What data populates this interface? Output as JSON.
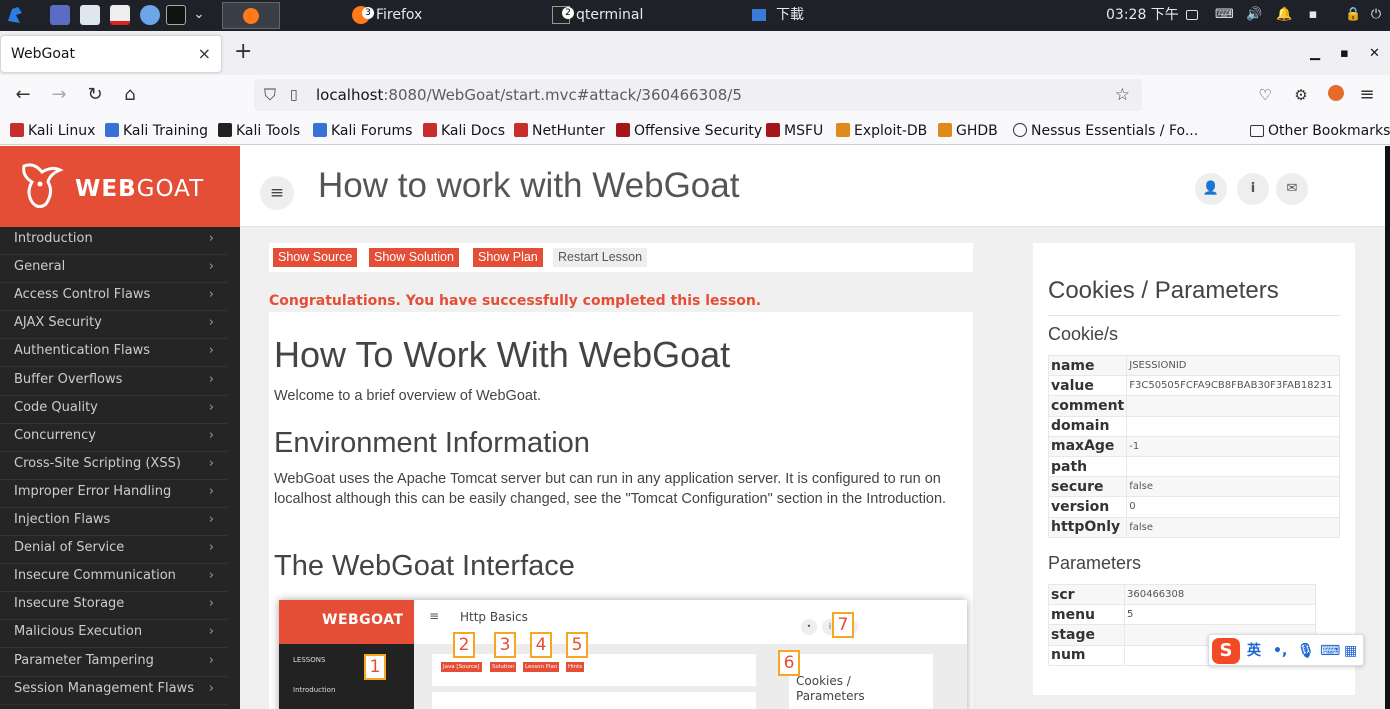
{
  "taskbar": {
    "tasks": [
      {
        "label": "Firefox",
        "badge": "3"
      },
      {
        "label": "qterminal",
        "badge": "2"
      },
      {
        "label": "下載"
      }
    ],
    "clock": "03:28 下午"
  },
  "browser": {
    "tab_title": "WebGoat",
    "tab_close": "×",
    "new_tab": "+",
    "url_host": "localhost",
    "url_path": ":8080/WebGoat/start.mvc#attack/360466308/5",
    "bookmarks": [
      "Kali Linux",
      "Kali Training",
      "Kali Tools",
      "Kali Forums",
      "Kali Docs",
      "NetHunter",
      "Offensive Security",
      "MSFU",
      "Exploit-DB",
      "GHDB",
      "Nessus Essentials / Fo..."
    ],
    "other_bookmarks": "Other Bookmarks"
  },
  "webgoat": {
    "logo_web": "WEB",
    "logo_goat": "GOAT",
    "page_title": "How to work with WebGoat",
    "sidebar": [
      "Introduction",
      "General",
      "Access Control Flaws",
      "AJAX Security",
      "Authentication Flaws",
      "Buffer Overflows",
      "Code Quality",
      "Concurrency",
      "Cross-Site Scripting (XSS)",
      "Improper Error Handling",
      "Injection Flaws",
      "Denial of Service",
      "Insecure Communication",
      "Insecure Storage",
      "Malicious Execution",
      "Parameter Tampering",
      "Session Management Flaws"
    ],
    "buttons": {
      "show_source": "Show Source",
      "show_solution": "Show Solution",
      "show_plan": "Show Plan",
      "restart": "Restart Lesson"
    },
    "congrats": "Congratulations. You have successfully completed this lesson.",
    "lesson": {
      "h1": "How To Work With WebGoat",
      "intro": "Welcome to a brief overview of WebGoat.",
      "h2_env": "Environment Information",
      "env_text": "WebGoat uses the Apache Tomcat server but can run in any application server. It is configured to run on localhost although this can be easily changed, see the \"Tomcat Configuration\" section in the Introduction.",
      "h2_iface": "The WebGoat Interface"
    },
    "screenshot": {
      "logo": "WEBGOAT",
      "title": "Http Basics",
      "side_lessons": "LESSONS",
      "side_intro": "Introduction",
      "buttons": [
        "Java [Source]",
        "Solution",
        "Lesson Plan",
        "Hints"
      ],
      "right_title": "Cookies / Parameters",
      "numbers": [
        "1",
        "2",
        "3",
        "4",
        "5",
        "6",
        "7"
      ]
    },
    "cookies_panel": {
      "title": "Cookies / Parameters",
      "cookie_heading": "Cookie/s",
      "cookie_rows": [
        {
          "key": "name",
          "value": "JSESSIONID"
        },
        {
          "key": "value",
          "value": "F3C50505FCFA9CB8FBAB30F3FAB18231"
        },
        {
          "key": "comment",
          "value": ""
        },
        {
          "key": "domain",
          "value": ""
        },
        {
          "key": "maxAge",
          "value": "-1"
        },
        {
          "key": "path",
          "value": ""
        },
        {
          "key": "secure",
          "value": "false"
        },
        {
          "key": "version",
          "value": "0"
        },
        {
          "key": "httpOnly",
          "value": "false"
        }
      ],
      "params_heading": "Parameters",
      "param_rows": [
        {
          "key": "scr",
          "value": "360466308"
        },
        {
          "key": "menu",
          "value": "5"
        },
        {
          "key": "stage",
          "value": ""
        },
        {
          "key": "num",
          "value": ""
        }
      ]
    }
  },
  "ime": {
    "logo": "S",
    "lang": "英",
    "punct": "•,"
  }
}
